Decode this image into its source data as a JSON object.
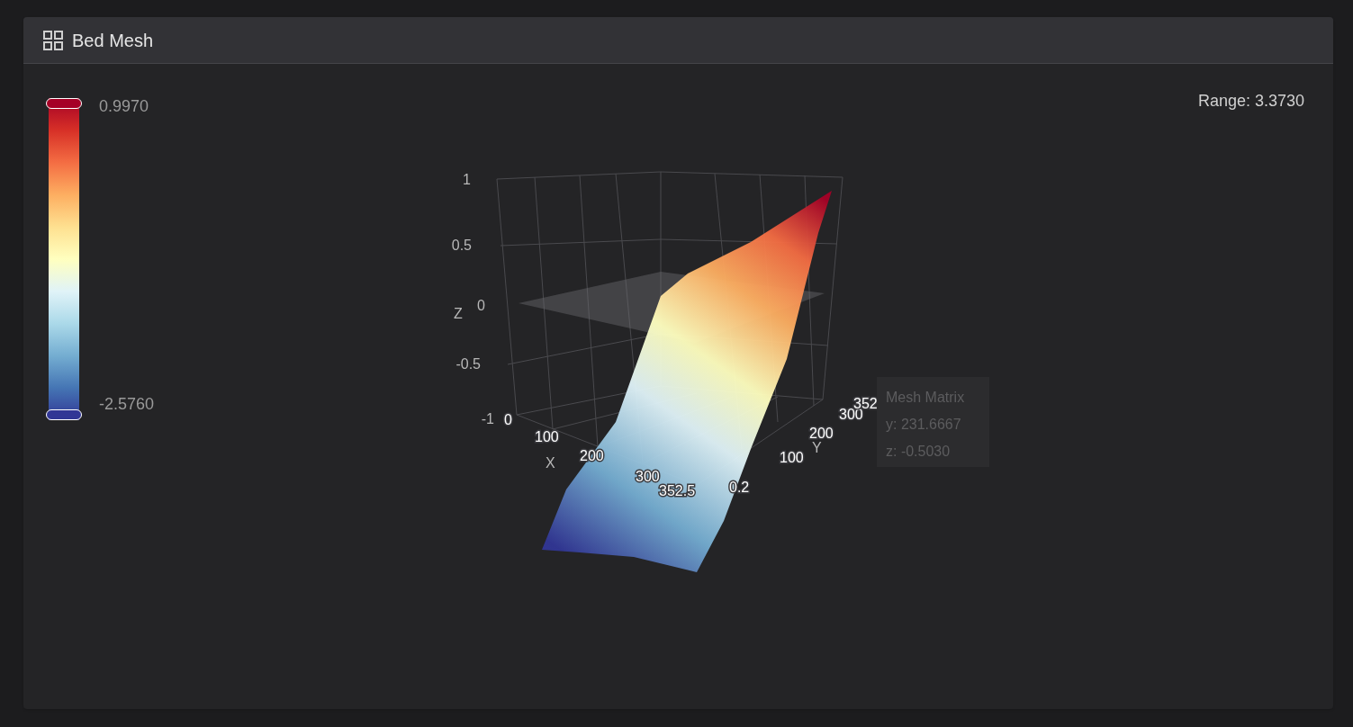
{
  "panel": {
    "title": "Bed Mesh"
  },
  "colorbar": {
    "max": "0.9970",
    "min": "-2.5760"
  },
  "range": "Range: 3.3730",
  "plot": {
    "z_title": "Z",
    "x_title": "X",
    "y_title": "Y",
    "z_ticks": [
      "1",
      "0.5",
      "0",
      "-0.5",
      "-1"
    ],
    "x_ticks": [
      "0",
      "100",
      "200",
      "300",
      "352.5"
    ],
    "y_ticks": [
      "0.2",
      "100",
      "200",
      "300",
      "352"
    ],
    "tooltip": {
      "title": "Mesh Matrix",
      "lines": [
        "y: 231.6667",
        "z: -0.5030"
      ]
    }
  }
}
